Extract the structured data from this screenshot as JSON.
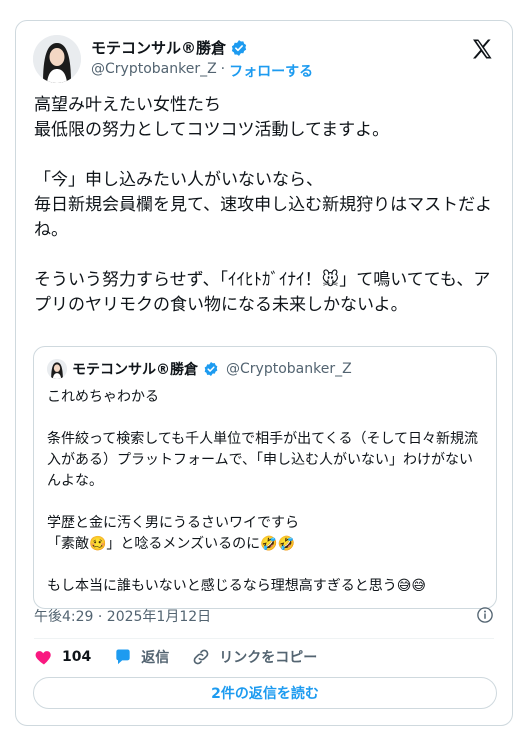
{
  "author": {
    "name": "モテコンサル®勝倉",
    "handle": "@Cryptobanker_Z",
    "separator": "·",
    "follow_label": "フォローする"
  },
  "tweet_paragraphs": [
    "高望み叶えたい女性たち\n最低限の努力としてコツコツ活動してますよ。",
    "「今」申し込みたい人がいないなら、\n毎日新規会員欄を見て、速攻申し込む新規狩りはマストだよね。",
    "そういう努力すらせず、「ｲｲﾋﾄｶﾞｲﾅｲ！🐭」て鳴いてても、アプリのヤリモクの食い物になる未来しかないよ。"
  ],
  "quote": {
    "name": "モテコンサル®勝倉",
    "handle": "@Cryptobanker_Z",
    "paragraphs": [
      "これめちゃわかる",
      "条件絞って検索しても千人単位で相手が出てくる（そして日々新規流入がある）プラットフォームで、「申し込む人がいない」わけがないんよな。",
      "学歴と金に汚く男にうるさいワイですら\n「素敵🥴」と唸るメンズいるのに🤣🤣",
      "もし本当に誰もいないと感じるなら理想高すぎると思う😅😅"
    ]
  },
  "timestamp": "午後4:29 · 2025年1月12日",
  "actions": {
    "like_count": "104",
    "reply_label": "返信",
    "copy_link_label": "リンクをコピー"
  },
  "read_replies_label": "2件の返信を読む",
  "colors": {
    "accent": "#1d9bf0",
    "like": "#f91880",
    "border": "#cfd9de",
    "muted": "#536471"
  },
  "icons": [
    "verified-badge-icon",
    "x-logo-icon",
    "info-icon",
    "heart-icon",
    "reply-bubble-icon",
    "link-icon"
  ]
}
